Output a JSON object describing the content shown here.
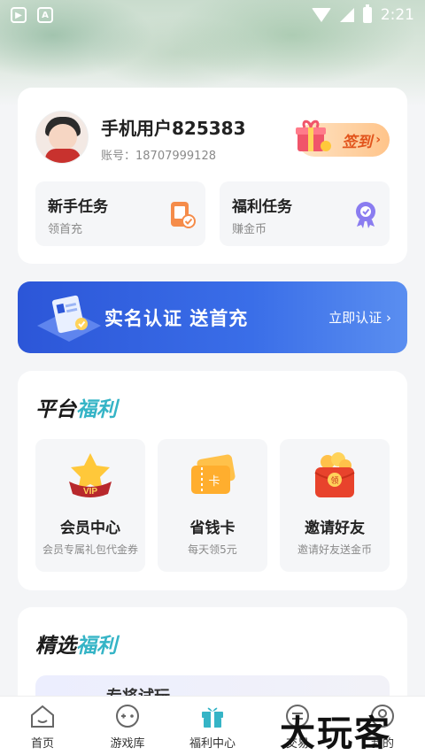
{
  "status_bar": {
    "time": "2:21"
  },
  "profile": {
    "username": "手机用户825383",
    "account": "账号：18707999128",
    "signin_label": "签到",
    "signin_chevron": "›"
  },
  "tasks": [
    {
      "title": "新手任务",
      "subtitle": "领首充"
    },
    {
      "title": "福利任务",
      "subtitle": "赚金币"
    }
  ],
  "banner": {
    "title": "实名认证  送首充",
    "link": "立即认证 ›"
  },
  "platform_welfare": {
    "title_main": "平台",
    "title_accent": "福利",
    "items": [
      {
        "title": "会员中心",
        "subtitle": "会员专属礼包代金券",
        "icon": "vip-icon",
        "badge": "VIP"
      },
      {
        "title": "省钱卡",
        "subtitle": "每天领5元",
        "icon": "card-icon",
        "badge": "卡"
      },
      {
        "title": "邀请好友",
        "subtitle": "邀请好友送金币",
        "icon": "red-envelope-icon",
        "badge": "领"
      }
    ]
  },
  "selected_welfare": {
    "title_main": "精选",
    "title_accent": "福利",
    "preview_title": "专将试玩"
  },
  "bottom_nav": [
    {
      "label": "首页",
      "icon": "home-icon"
    },
    {
      "label": "游戏库",
      "icon": "gamepad-icon"
    },
    {
      "label": "福利中心",
      "icon": "gift-icon",
      "active": true
    },
    {
      "label": "交易",
      "icon": "trade-icon"
    },
    {
      "label": "我的",
      "icon": "user-icon"
    }
  ],
  "watermark": "大玩客",
  "colors": {
    "accent": "#35b4c6",
    "banner": "#3a6ee8",
    "signin": "#e2541c"
  }
}
